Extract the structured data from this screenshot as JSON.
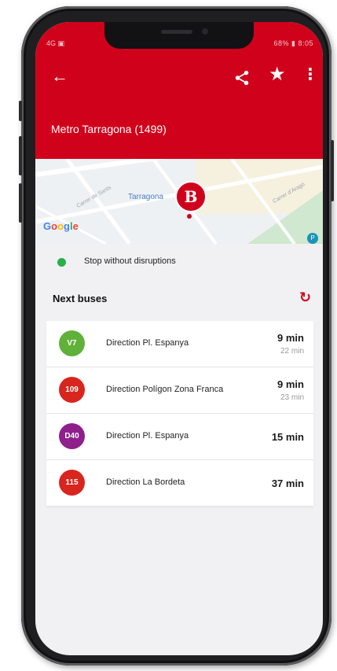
{
  "status_bar": {
    "left": "4G ▣",
    "right": "68% ▮ 8:05"
  },
  "app_bar": {
    "back_icon": "arrow-left-icon",
    "share_icon": "share-icon",
    "star_icon": "star-icon",
    "more_icon": "more-vert-icon",
    "title": "Metro Tarragona (1499)",
    "color": "#d0021b"
  },
  "map": {
    "place_label": "Tarragona",
    "google": [
      "G",
      "o",
      "o",
      "g",
      "l",
      "e"
    ],
    "street_1": "Carrer de Sants",
    "street_2": "Carrer d'Aragó",
    "pin_letter": "B",
    "poi": "P"
  },
  "stop_status": {
    "text": "Stop without disruptions",
    "color": "#27b04b"
  },
  "next_buses": {
    "title": "Next buses",
    "refresh_icon": "refresh-icon",
    "items": [
      {
        "line": "V7",
        "color": "#5fb13a",
        "direction": "Direction Pl. Espanya",
        "eta": "9 min",
        "next": "22 min"
      },
      {
        "line": "109",
        "color": "#d8261f",
        "direction": "Direction Polígon Zona Franca",
        "eta": "9 min",
        "next": "23 min"
      },
      {
        "line": "D40",
        "color": "#8e1f8b",
        "direction": "Direction Pl. Espanya",
        "eta": "15 min",
        "next": ""
      },
      {
        "line": "115",
        "color": "#d8261f",
        "direction": "Direction La Bordeta",
        "eta": "37 min",
        "next": ""
      }
    ]
  }
}
